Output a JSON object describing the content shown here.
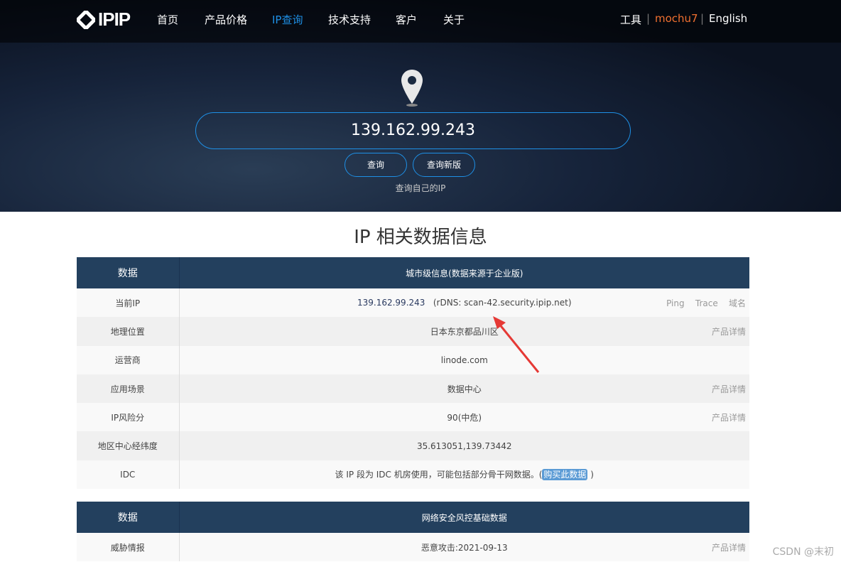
{
  "nav": {
    "logo": "IPIP",
    "items": [
      "首页",
      "产品价格",
      "IP查询",
      "技术支持",
      "客户",
      "关于"
    ],
    "active": "IP查询",
    "tools": "工具",
    "user": "mochu7",
    "lang": "English"
  },
  "search": {
    "value": "139.162.99.243",
    "query": "查询",
    "query_new": "查询新版",
    "self": "查询自己的IP"
  },
  "title": "IP 相关数据信息",
  "table1": {
    "header": [
      "数据",
      "城市级信息(数据来源于企业版)"
    ],
    "rows": [
      {
        "label": "当前IP",
        "ip": "139.162.99.243",
        "rdns": "(rDNS: scan-42.security.ipip.net)",
        "links": [
          "Ping",
          "Trace",
          "域名"
        ]
      },
      {
        "label": "地理位置",
        "value": "日本东京都品川区",
        "extra": "产品详情"
      },
      {
        "label": "运营商",
        "value": "linode.com"
      },
      {
        "label": "应用场景",
        "value": "数据中心",
        "extra": "产品详情"
      },
      {
        "label": "IP风险分",
        "value": "90(中危)",
        "extra": "产品详情"
      },
      {
        "label": "地区中心经纬度",
        "value": "35.613051,139.73442"
      },
      {
        "label": "IDC",
        "value": "该 IP 段为 IDC 机房使用，可能包括部分骨干网数据。(",
        "link": "购买此数据",
        "close": ")"
      }
    ]
  },
  "table2": {
    "header": [
      "数据",
      "网络安全风控基础数据"
    ],
    "rows": [
      {
        "label": "威胁情报",
        "value": "恶意攻击:2021-09-13",
        "extra": "产品详情"
      }
    ]
  },
  "watermark": "CSDN @末初",
  "colors": {
    "nav_active": "#1e90e6",
    "user": "#f07030",
    "table_header": "#23405e",
    "arrow": "#e53935"
  }
}
